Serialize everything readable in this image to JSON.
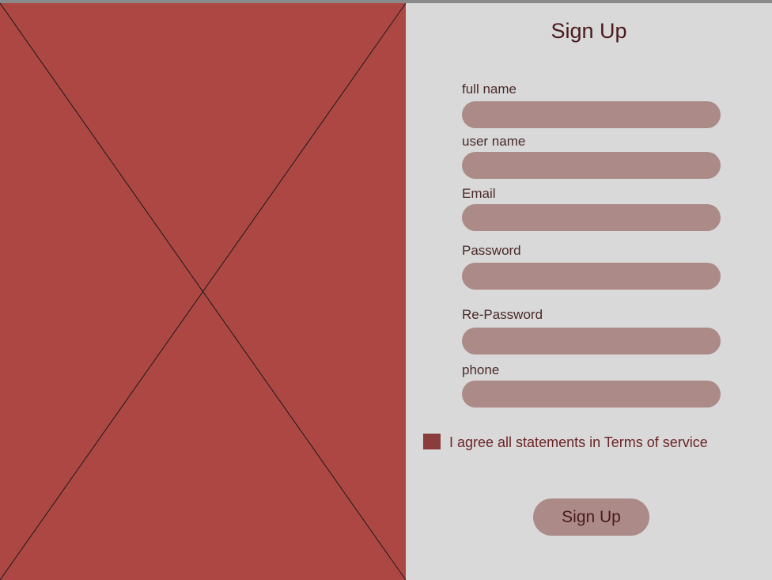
{
  "form": {
    "title": "Sign Up",
    "fields": [
      {
        "label": "full name",
        "value": ""
      },
      {
        "label": "user name",
        "value": ""
      },
      {
        "label": "Email",
        "value": ""
      },
      {
        "label": "Password",
        "value": ""
      },
      {
        "label": "Re-Password",
        "value": ""
      },
      {
        "label": "phone",
        "value": ""
      }
    ],
    "terms_label": "I agree all statements in Terms of service",
    "submit_label": "Sign Up"
  },
  "colors": {
    "image_placeholder": "#ad4744",
    "panel_background": "#d9d9d9",
    "field_fill": "#ab8a88",
    "checkbox_fill": "#8b3d3d",
    "title_text": "#4a1a1c",
    "terms_text": "#6b2426"
  },
  "image_placeholder": {
    "icon": "image-placeholder-cross-icon"
  }
}
